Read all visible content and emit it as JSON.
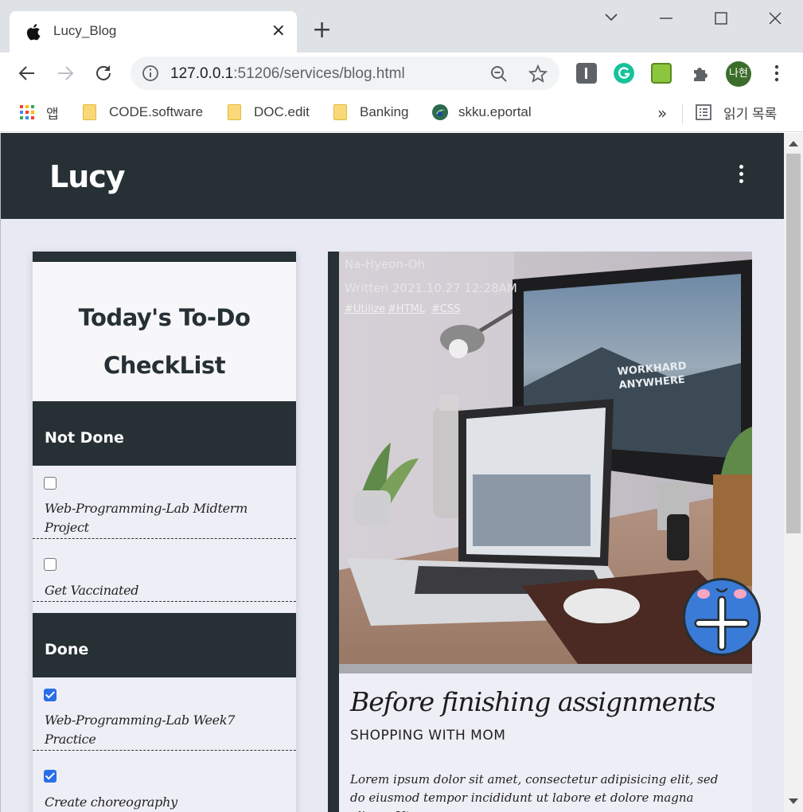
{
  "browser": {
    "tab_title": "Lucy_Blog",
    "tab_close": "×",
    "new_tab": "+",
    "url_host": "127.0.0.1",
    "url_rest": ":51206/services/blog.html",
    "profile_label": "나현",
    "bookmarks": [
      {
        "label": "앱",
        "icon": "apps-grid-icon"
      },
      {
        "label": "CODE.software",
        "icon": "folder-icon"
      },
      {
        "label": "DOC.edit",
        "icon": "folder-icon"
      },
      {
        "label": "Banking",
        "icon": "folder-icon"
      },
      {
        "label": "skku.eportal",
        "icon": "site-icon"
      }
    ],
    "bookmarks_more": "»",
    "reading_list": "읽기 목록"
  },
  "site": {
    "title": "Lucy"
  },
  "checklist": {
    "title_line1": "Today's To-Do",
    "title_line2": "CheckList",
    "not_done_label": "Not Done",
    "done_label": "Done",
    "not_done": [
      {
        "text": "Web-Programming-Lab Midterm Project",
        "checked": false
      },
      {
        "text": "Get Vaccinated",
        "checked": false
      }
    ],
    "done": [
      {
        "text": "Web-Programming-Lab Week7 Practice",
        "checked": true
      },
      {
        "text": "Create choreography",
        "checked": true
      }
    ]
  },
  "post": {
    "author": "Na-Hyeon-Oh",
    "written": "Written 2021.10.27 12:28AM",
    "tags": [
      "#Utilize",
      "#HTML",
      "#CSS"
    ],
    "image_caption_line1": "WORKHARD",
    "image_caption_line2": "ANYWHERE",
    "title": "Before finishing assignments",
    "subtitle": "SHOPPING WITH MOM",
    "body": "Lorem ipsum dolor sit amet, consectetur adipisicing elit, sed do eiusmod tempor incididunt ut labore et dolore magna aliqua. Ut"
  },
  "colors": {
    "header_bg": "#263035",
    "page_bg": "#e8e9f3",
    "fab": "#3b7bd8"
  }
}
